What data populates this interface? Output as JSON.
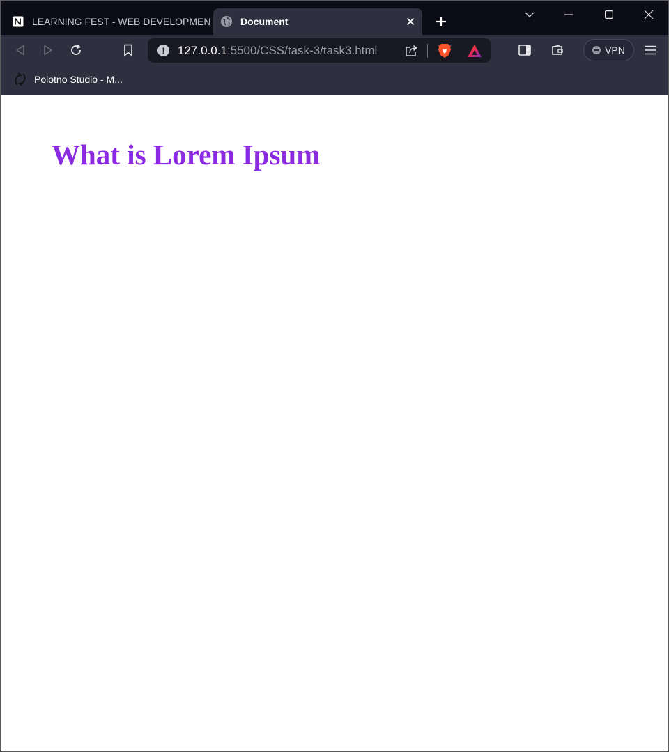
{
  "browser": {
    "tabs": [
      {
        "title": "LEARNING FEST - WEB DEVELOPMENT",
        "active": false,
        "favicon": "notion-icon"
      },
      {
        "title": "Document",
        "active": true,
        "favicon": "globe-icon"
      }
    ],
    "url": {
      "host": "127.0.0.1",
      "path": ":5500/CSS/task-3/task3.html"
    },
    "vpn_label": "VPN",
    "bookmarks": [
      {
        "label": "Polotno Studio - M..."
      }
    ]
  },
  "page": {
    "heading": "What is Lorem Ipsum",
    "heading_color": "#8a2be2"
  },
  "colors": {
    "tabstrip_bg": "#0b0c15",
    "toolbar_bg": "#2e3040",
    "urlbar_bg": "#181923"
  }
}
